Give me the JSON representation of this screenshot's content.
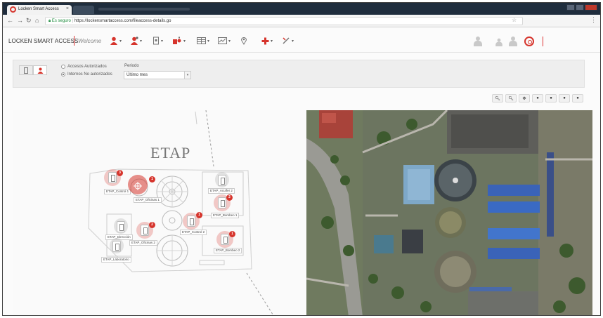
{
  "browser": {
    "tab_title": "Locken Smart Access",
    "tab_close": "×",
    "url_secure": "Es seguro",
    "url": "https://lockensmartaccess.com/fileaccess-details.go"
  },
  "app": {
    "brand": "LOCKEN SMART ACCESS",
    "welcome": "Welcome"
  },
  "filter": {
    "radio_authorized": "Accesos Autorizados",
    "radio_unauthorized": "Internos No autorizados",
    "periodo_label": "Periodo",
    "periodo_value": "Último mes"
  },
  "plan": {
    "title": "ETAP",
    "markers": [
      {
        "label": "ETAP_Control 1",
        "badge": "3"
      },
      {
        "label": "ETAP_Oficinas 1",
        "badge": "1"
      },
      {
        "label": "ETAP_Acuífer 2",
        "badge": ""
      },
      {
        "label": "ETAP_Bombeo 1",
        "badge": "2"
      },
      {
        "label": "ETAP_Control 2",
        "badge": "1"
      },
      {
        "label": "ETAP_Dirección",
        "badge": ""
      },
      {
        "label": "ETAP_Oficinas 2",
        "badge": "2"
      },
      {
        "label": "ETAP_Laboratorio",
        "badge": ""
      },
      {
        "label": "ETAP_Bombeo 2",
        "badge": "1"
      }
    ]
  },
  "colors": {
    "accent": "#d6342c",
    "chrome": "#1f2d3d"
  }
}
